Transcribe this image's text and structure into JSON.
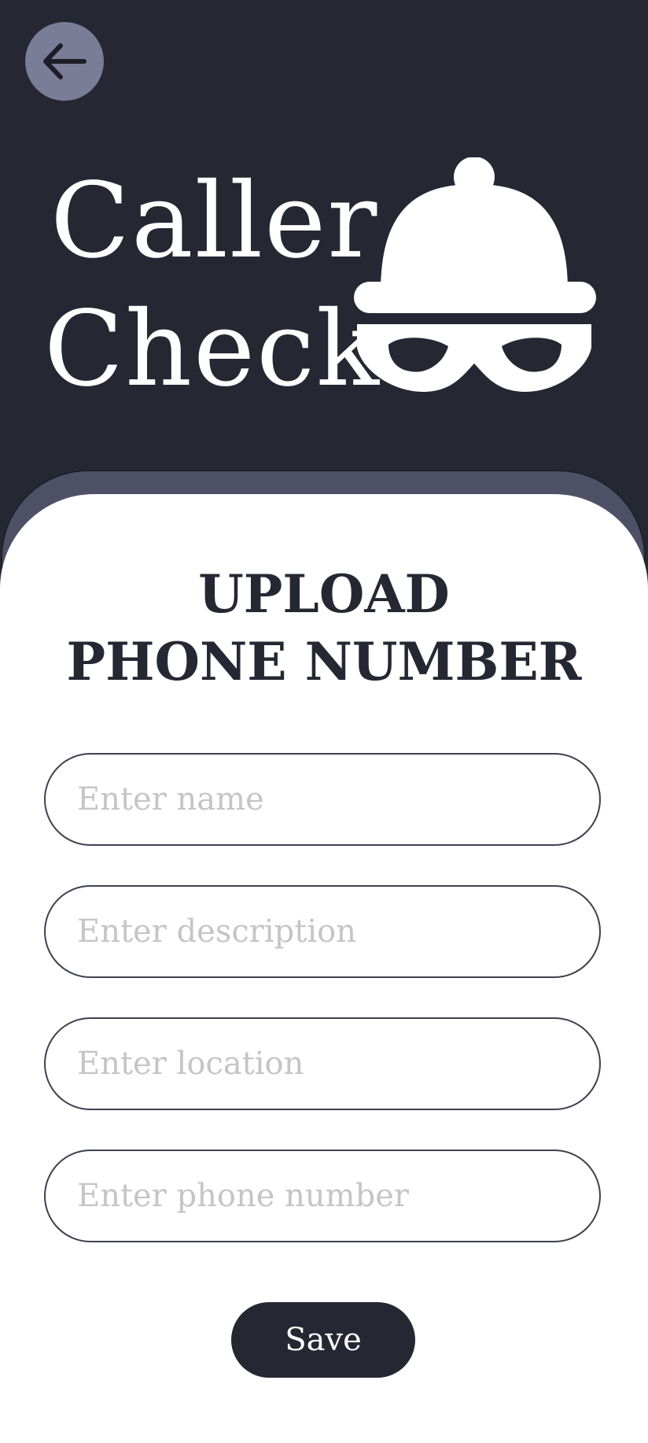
{
  "header": {
    "back_icon": "arrow-left-icon",
    "brand_line1": "Caller",
    "brand_line2": "Check",
    "logo_icon": "incognito-spy-icon"
  },
  "form": {
    "title_line1": "UPLOAD",
    "title_line2": "PHONE NUMBER",
    "name_placeholder": "Enter name",
    "description_placeholder": "Enter description",
    "location_placeholder": "Enter location",
    "phone_placeholder": "Enter phone number",
    "save_label": "Save"
  },
  "colors": {
    "header_bg": "#252733",
    "sheet_accent": "#4e5165",
    "back_button_bg": "#7a7d97",
    "placeholder": "#c5c5c9"
  }
}
